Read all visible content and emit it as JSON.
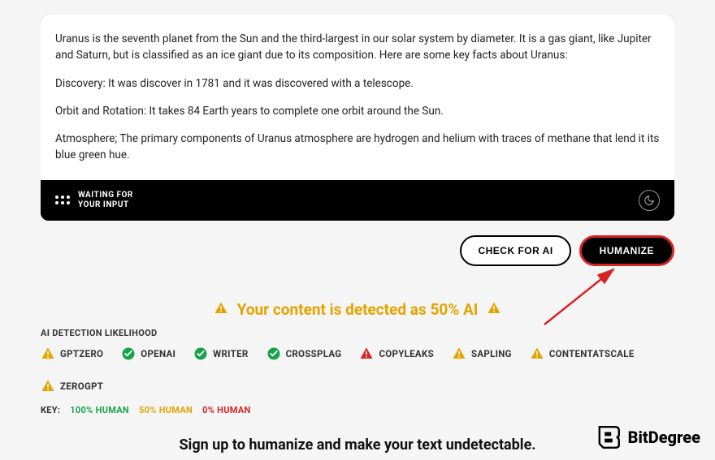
{
  "editor": {
    "paragraphs": [
      "Uranus is the seventh planet from the Sun and the third-largest in our solar system by diameter. It is a gas giant, like Jupiter and Saturn, but is classified as an ice giant due to its composition. Here are some key facts about Uranus:",
      "Discovery: It was discover in 1781 and it was discovered with a telescope.",
      "Orbit and Rotation: It takes 84 Earth years to complete one orbit around the Sun.",
      "Atmosphere; The primary components of Uranus atmosphere are hydrogen and helium with traces of methane that lend it its blue green hue."
    ],
    "status_line1": "WAITING FOR",
    "status_line2": "YOUR INPUT"
  },
  "actions": {
    "check_label": "CHECK FOR AI",
    "humanize_label": "HUMANIZE"
  },
  "detection": {
    "headline": "Your content is detected as 50% AI",
    "section_label": "AI DETECTION LIKELIHOOD",
    "detectors": [
      {
        "name": "GPTZERO",
        "status": "amber"
      },
      {
        "name": "OPENAI",
        "status": "green"
      },
      {
        "name": "WRITER",
        "status": "green"
      },
      {
        "name": "CROSSPLAG",
        "status": "green"
      },
      {
        "name": "COPYLEAKS",
        "status": "red"
      },
      {
        "name": "SAPLING",
        "status": "amber"
      },
      {
        "name": "CONTENTATSCALE",
        "status": "amber"
      },
      {
        "name": "ZEROGPT",
        "status": "amber"
      }
    ],
    "key_label": "KEY:",
    "key_items": [
      {
        "label": "100% HUMAN",
        "color": "green"
      },
      {
        "label": "50% HUMAN",
        "color": "amber"
      },
      {
        "label": "0% HUMAN",
        "color": "red"
      }
    ]
  },
  "signup_cta": "Sign up to humanize and make your text undetectable.",
  "brand": "BitDegree"
}
